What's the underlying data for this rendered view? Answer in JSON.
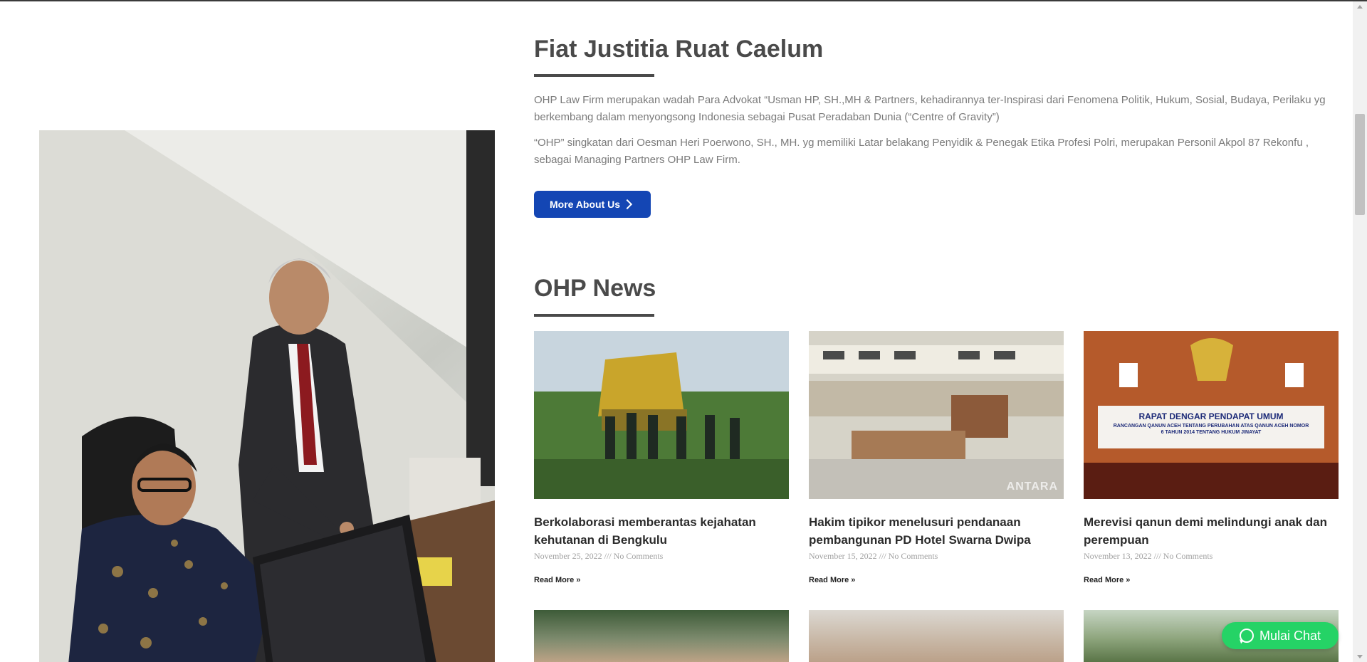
{
  "about": {
    "title": "Fiat Justitia Ruat Caelum",
    "paragraph1": "OHP Law Firm merupakan wadah Para Advokat “Usman HP, SH.,MH & Partners, kehadirannya  ter-Inspirasi dari Fenomena Politik, Hukum, Sosial, Budaya, Perilaku  yg berkembang dalam  menyongsong Indonesia sebagai Pusat Peradaban Dunia (“Centre of Gravity”)",
    "paragraph2": "“OHP” singkatan dari Oesman Heri Poerwono, SH., MH. yg memiliki Latar belakang Penyidik & Penegak Etika Profesi Polri, merupakan Personil Akpol 87 Rekonfu , sebagai Managing Partners OHP Law Firm.",
    "button_label": "More About Us"
  },
  "news": {
    "title": "OHP News",
    "items": [
      {
        "title": "Berkolaborasi memberantas kejahatan kehutanan di Bengkulu",
        "date": "November 25, 2022",
        "comments": "No Comments",
        "read_more": "Read More »"
      },
      {
        "title": "Hakim tipikor menelusuri pendanaan pembangunan PD Hotel Swarna Dwipa",
        "date": "November 15, 2022",
        "comments": "No Comments",
        "read_more": "Read More »",
        "image_watermark": "ANTARA"
      },
      {
        "title": "Merevisi qanun demi melindungi anak dan perempuan",
        "date": "November 13, 2022",
        "comments": "No Comments",
        "read_more": "Read More »",
        "banner_heading": "RAPAT DENGAR PENDAPAT UMUM",
        "banner_subtext": "RANCANGAN QANUN ACEH TENTANG PERUBAHAN ATAS QANUN ACEH NOMOR 6 TAHUN 2014 TENTANG HUKUM JINAYAT"
      }
    ],
    "meta_separator": "///"
  },
  "chat": {
    "label": "Mulai Chat",
    "icon": "whatsapp-icon"
  },
  "colors": {
    "button_blue": "#1446b4",
    "chat_green": "#25d366",
    "heading": "#4a4a4a",
    "body_text": "#7a7a7a"
  }
}
